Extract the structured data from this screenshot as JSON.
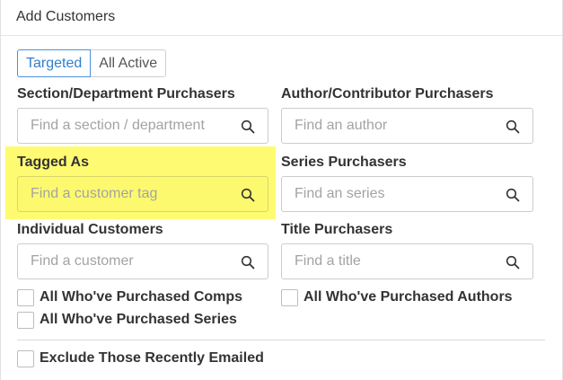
{
  "panel": {
    "title": "Add Customers"
  },
  "toggle": {
    "targeted": "Targeted",
    "all_active": "All Active"
  },
  "fields": {
    "section": {
      "label": "Section/Department Purchasers",
      "placeholder": "Find a section / department"
    },
    "author": {
      "label": "Author/Contributor Purchasers",
      "placeholder": "Find an author"
    },
    "tag": {
      "label": "Tagged As",
      "placeholder": "Find a customer tag"
    },
    "series": {
      "label": "Series Purchasers",
      "placeholder": "Find an series"
    },
    "customer": {
      "label": "Individual Customers",
      "placeholder": "Find a customer"
    },
    "title": {
      "label": "Title Purchasers",
      "placeholder": "Find a title"
    }
  },
  "checkboxes": {
    "comps": "All Who've Purchased Comps",
    "authors": "All Who've Purchased Authors",
    "series": "All Who've Purchased Series",
    "exclude": "Exclude Those Recently Emailed"
  },
  "colors": {
    "accent": "#2f7fcf",
    "highlight": "#fefb72"
  }
}
